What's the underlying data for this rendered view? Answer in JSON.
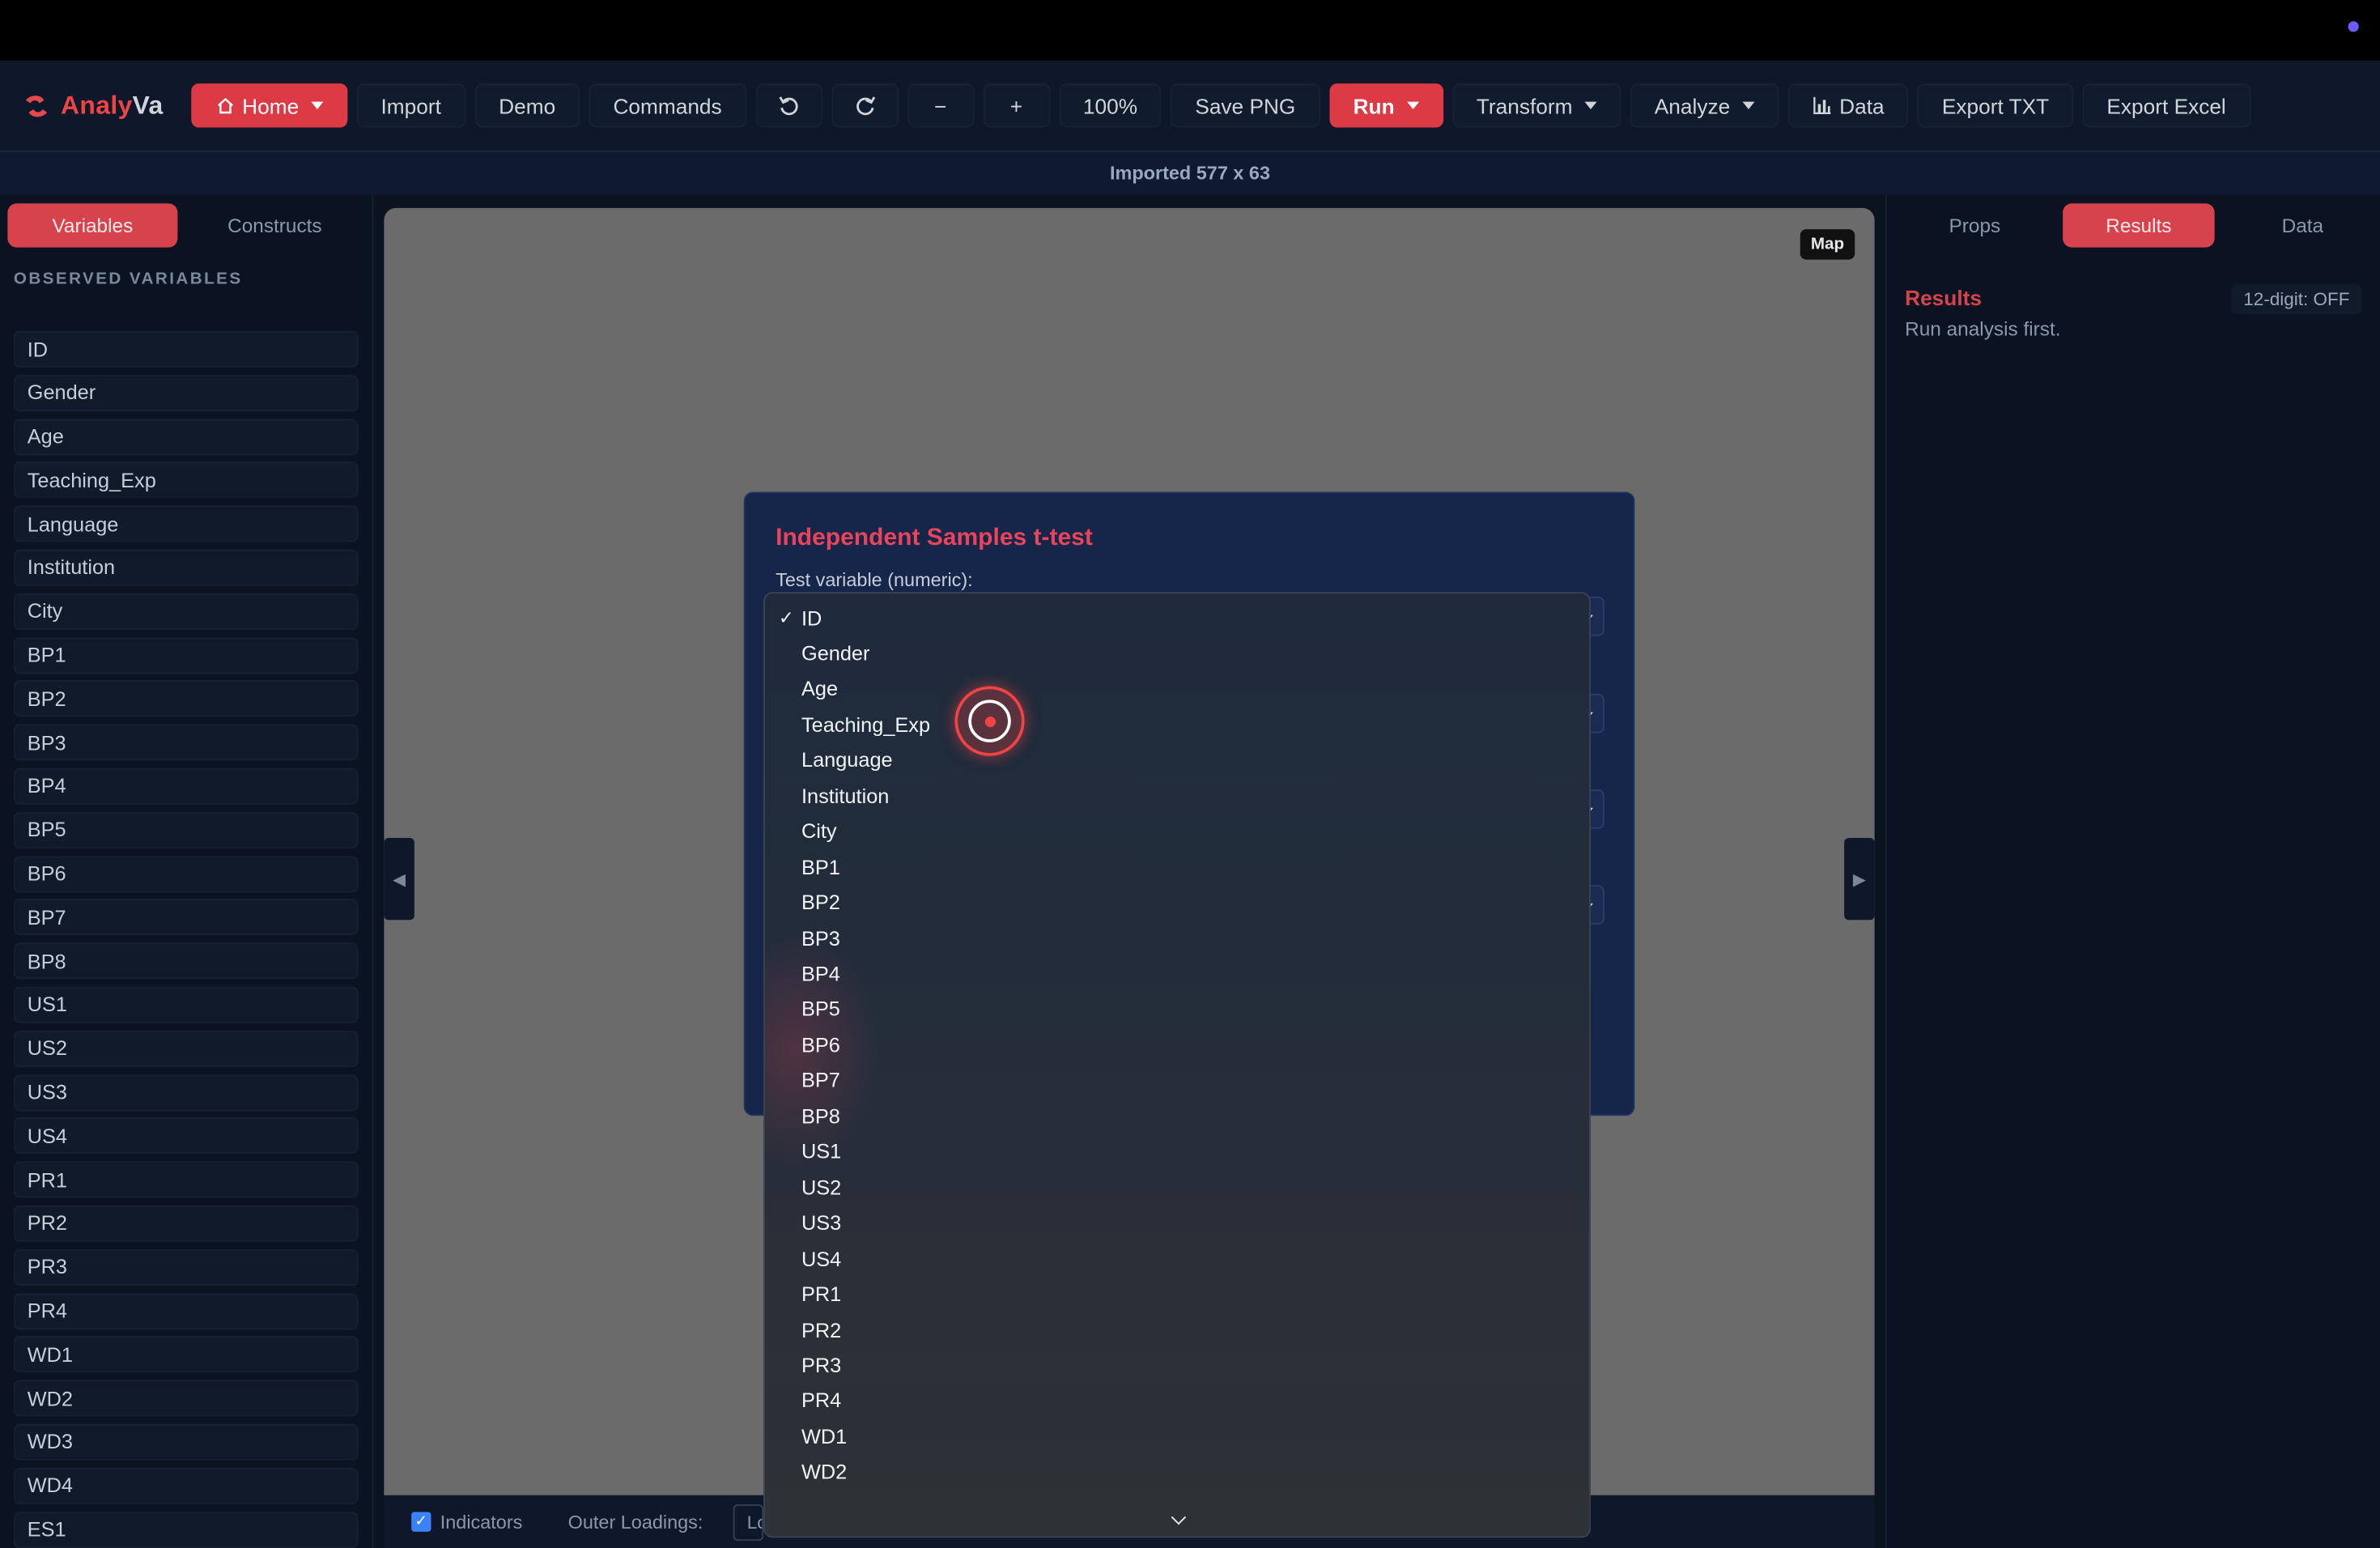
{
  "app": {
    "logo_part1": "Analy",
    "logo_part2": "Va"
  },
  "toolbar": {
    "home": "Home",
    "import": "Import",
    "demo": "Demo",
    "commands": "Commands",
    "zoom_out": "−",
    "zoom_in": "+",
    "zoom_level": "100%",
    "save_png": "Save PNG",
    "run": "Run",
    "transform": "Transform",
    "analyze": "Analyze",
    "data": "Data",
    "export_txt": "Export TXT",
    "export_excel": "Export Excel"
  },
  "status": {
    "text": "Imported 577 x 63"
  },
  "left_panel": {
    "tabs": [
      "Variables",
      "Constructs"
    ],
    "active_tab": "Variables",
    "section_title": "OBSERVED VARIABLES",
    "variables": [
      "ID",
      "Gender",
      "Age",
      "Teaching_Exp",
      "Language",
      "Institution",
      "City",
      "BP1",
      "BP2",
      "BP3",
      "BP4",
      "BP5",
      "BP6",
      "BP7",
      "BP8",
      "US1",
      "US2",
      "US3",
      "US4",
      "PR1",
      "PR2",
      "PR3",
      "PR4",
      "WD1",
      "WD2",
      "WD3",
      "WD4",
      "ES1"
    ]
  },
  "canvas": {
    "map_label": "Map",
    "footer": {
      "indicators_label": "Indicators",
      "outer_loadings_label": "Outer Loadings:",
      "outer_loadings_value": "Lo"
    }
  },
  "right_panel": {
    "tabs": [
      "Props",
      "Results",
      "Data"
    ],
    "active_tab": "Results",
    "results_title": "Results",
    "results_sub": "Run analysis first.",
    "digit_toggle": "12-digit: OFF"
  },
  "modal": {
    "title": "Independent Samples t-test",
    "test_variable_label": "Test variable (numeric):"
  },
  "dropdown": {
    "selected": "ID",
    "options": [
      "ID",
      "Gender",
      "Age",
      "Teaching_Exp",
      "Language",
      "Institution",
      "City",
      "BP1",
      "BP2",
      "BP3",
      "BP4",
      "BP5",
      "BP6",
      "BP7",
      "BP8",
      "US1",
      "US2",
      "US3",
      "US4",
      "PR1",
      "PR2",
      "PR3",
      "PR4",
      "WD1",
      "WD2"
    ],
    "check_mark": "✓"
  },
  "colors": {
    "accent": "#dc3a44",
    "modal_title": "#e8445a",
    "canvas_bg": "#6b6b6b"
  }
}
